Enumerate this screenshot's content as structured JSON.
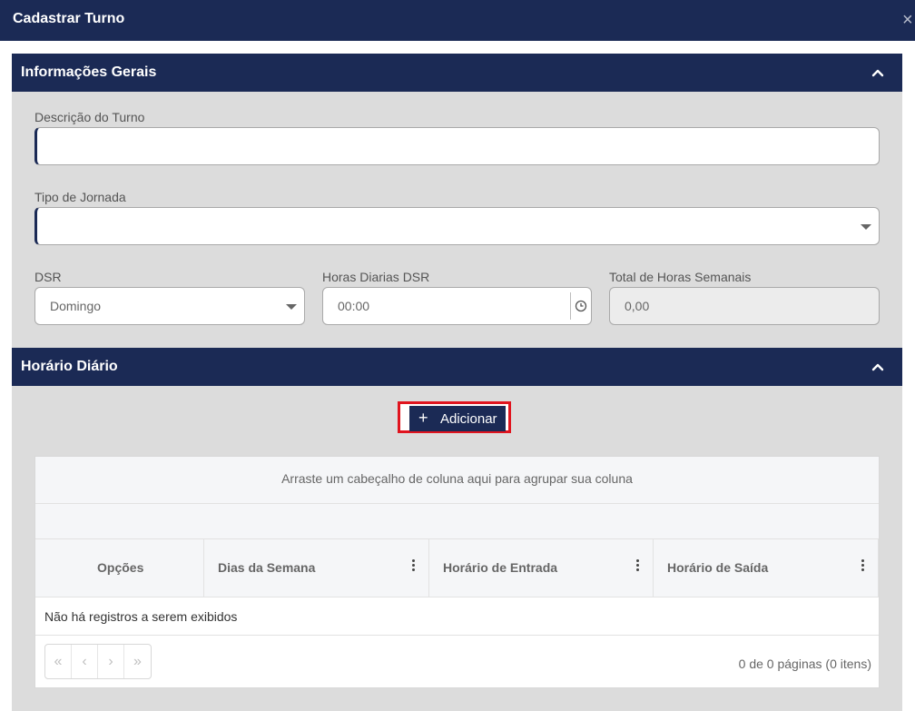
{
  "modal": {
    "title": "Cadastrar Turno",
    "close_glyph": "×"
  },
  "general_section": {
    "title": "Informações Gerais",
    "description_label": "Descrição do Turno",
    "description_value": "",
    "journey_type_label": "Tipo de Jornada",
    "journey_type_value": "",
    "dsr_label": "DSR",
    "dsr_value": "Domingo",
    "dsr_hours_label": "Horas Diarias DSR",
    "dsr_hours_value": "00:00",
    "weekly_total_label": "Total de Horas Semanais",
    "weekly_total_value": "0,00"
  },
  "daily_section": {
    "title": "Horário Diário",
    "add_button": {
      "icon": "plus-icon",
      "label": "Adicionar"
    }
  },
  "grid": {
    "group_panel_text": "Arraste um cabeçalho de coluna aqui para agrupar sua coluna",
    "columns": [
      "Opções",
      "Dias da Semana",
      "Horário de Entrada",
      "Horário de Saída"
    ],
    "empty_text": "Não há registros a serem exibidos",
    "pager": {
      "first": "«",
      "prev": "‹",
      "next": "›",
      "last": "»"
    },
    "page_info": "0 de 0 páginas (0 itens)"
  },
  "colors": {
    "header_bg": "#1b2a55",
    "panel_bg": "#dcdcdc",
    "highlight_border": "#e0141e"
  }
}
